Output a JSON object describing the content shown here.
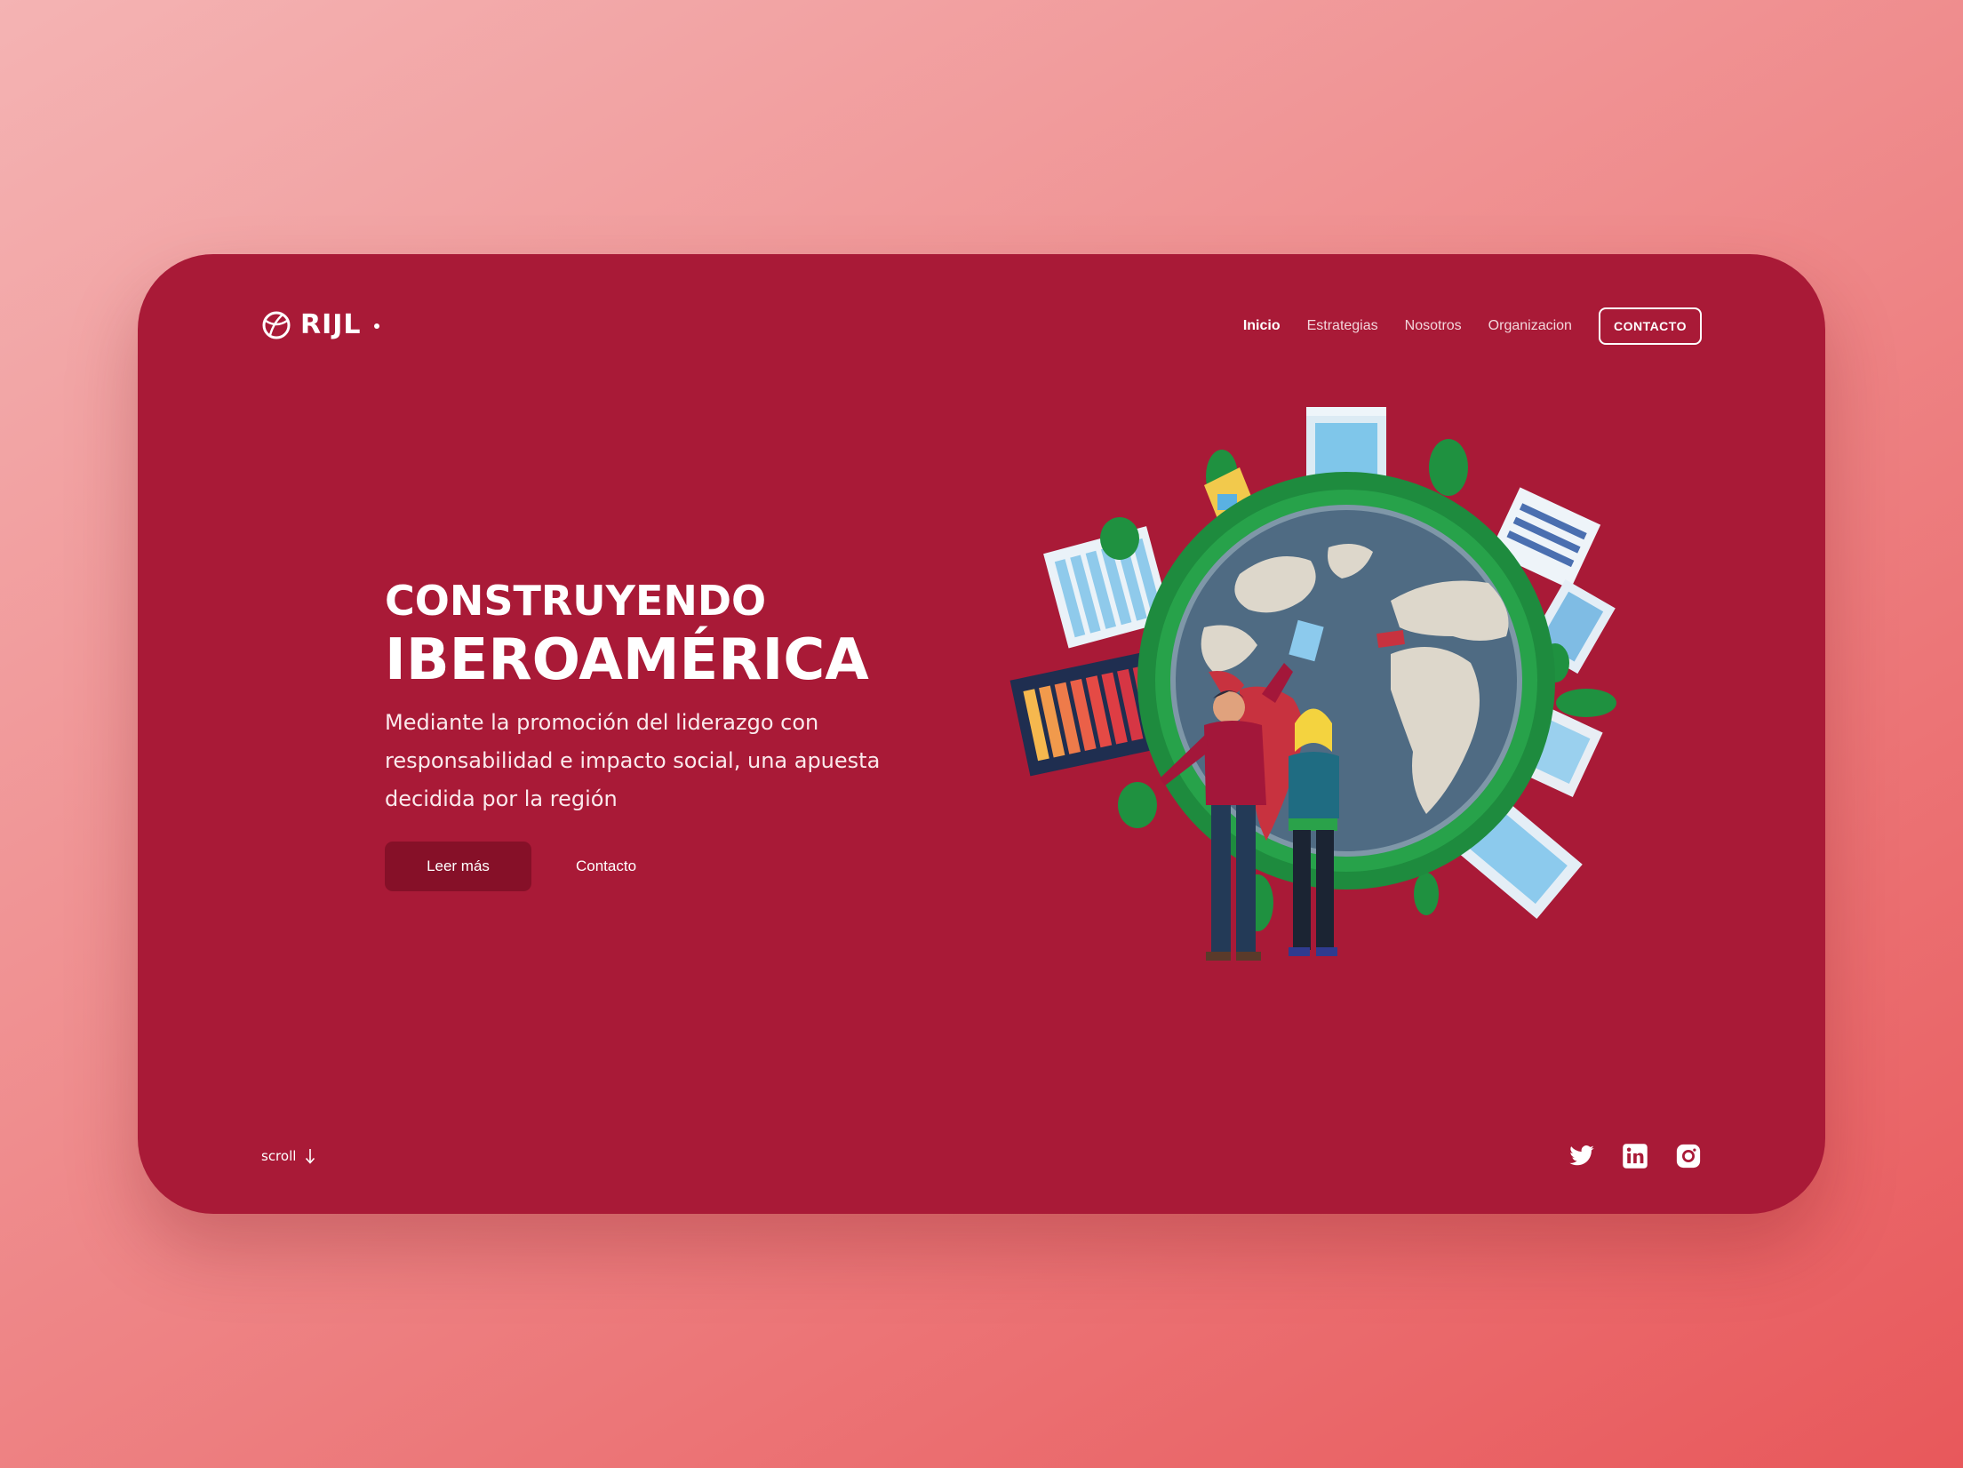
{
  "brand": {
    "name": "RIJL",
    "icon": "globe-icon"
  },
  "nav": {
    "items": [
      {
        "label": "Inicio",
        "active": true
      },
      {
        "label": "Estrategias",
        "active": false
      },
      {
        "label": "Nosotros",
        "active": false
      },
      {
        "label": "Organizacion",
        "active": false
      }
    ],
    "cta": "CONTACTO"
  },
  "hero": {
    "title_line1": "CONSTRUYENDO",
    "title_line2": "IBEROAMÉRICA",
    "description": "Mediante la promoción del liderazgo con responsabilidad e impacto social, una apuesta decidida por la región",
    "primary_button": "Leer más",
    "secondary_button": "Contacto"
  },
  "footer": {
    "scroll_label": "scroll",
    "scroll_icon": "arrow-down-icon",
    "social": [
      "twitter-icon",
      "linkedin-icon",
      "instagram-icon"
    ]
  },
  "colors": {
    "card": "#a91a37",
    "primary_button": "#861028",
    "text": "#ffffff"
  }
}
